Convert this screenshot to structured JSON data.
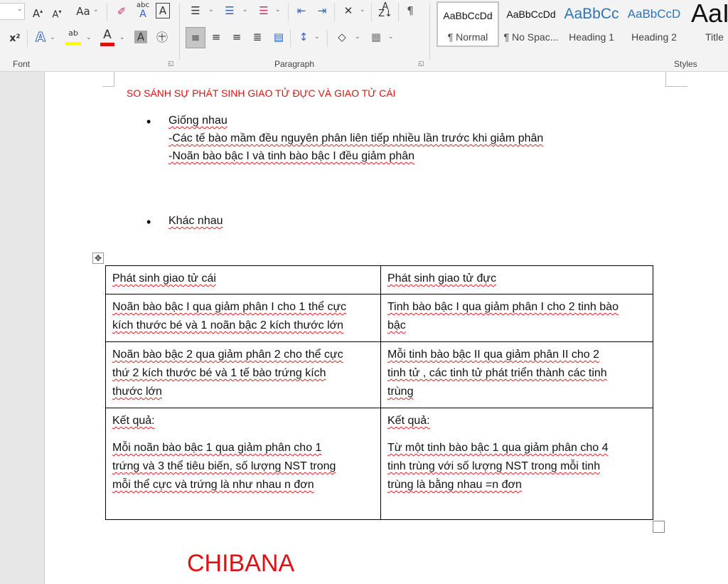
{
  "ribbon": {
    "font_group": {
      "label": "Font",
      "row1": {
        "grow_font": "A",
        "shrink_font": "A",
        "change_case": "Aa",
        "clear_format": "✐",
        "text_effects_abc": "abc",
        "char_border": "A"
      },
      "row2": {
        "superscript": "x²",
        "text_effect": "A",
        "highlight": "ab",
        "font_color": "A",
        "char_shading": "A",
        "enclose": "㊉"
      }
    },
    "paragraph_group": {
      "label": "Paragraph",
      "pilcrow": "¶",
      "sort": "↓",
      "bullets": "☰",
      "numbering": "☰",
      "multilevel": "☰",
      "decrease_indent": "⇤",
      "increase_indent": "⇥",
      "line_spacing": "↕",
      "shading": "◇",
      "borders": "▦"
    },
    "styles_group": {
      "label": "Styles",
      "items": [
        {
          "sample": "AaBbCcDd",
          "name": "¶ Normal"
        },
        {
          "sample": "AaBbCcDd",
          "name": "¶ No Spac..."
        },
        {
          "sample": "AaBbCc",
          "name": "Heading 1"
        },
        {
          "sample": "AaBbCcD",
          "name": "Heading 2"
        },
        {
          "sample": "AaI",
          "name": "Title"
        }
      ]
    }
  },
  "document": {
    "title": "SO SÁNH SỰ PHÁT SINH GIAO TỬ ĐỰC VÀ GIAO TỬ CÁI",
    "similar": {
      "heading": "Giống nhau",
      "lines": [
        "-Các tế bào mầm đều nguyên phân liên tiếp nhiều lần trước khi giảm phân",
        "-Noãn bào bậc I và tinh bào bậc I đều giảm phân"
      ]
    },
    "different": {
      "heading": "Khác nhau"
    },
    "table": {
      "headers": [
        "Phát sinh giao tử cái",
        "Phát sinh giao tử đực"
      ],
      "rows": [
        {
          "left": [
            "Noãn bào bậc I qua giảm phân I cho 1 thể cực",
            "kích thước bé và 1 noãn bậc 2 kích thước lớn"
          ],
          "right": [
            "Tinh bào bậc I qua giảm phân I cho 2 tinh bào",
            "bậc"
          ]
        },
        {
          "left": [
            "Noãn bào bậc 2 qua giảm phân 2 cho thể cực",
            "thứ 2 kích thước bé và 1 tế bào trứng kích",
            "thước lớn"
          ],
          "right": [
            "Mỗi tinh bào bậc II qua giảm phân II cho 2",
            "tinh tử , các tinh tử phát triển thành các tinh",
            "trùng"
          ]
        },
        {
          "left_heading": "Kết quả:",
          "left": [
            "Mỗi noãn bào bậc 1 qua giảm phân cho 1",
            "trứng và 3 thể tiêu biến, số lượng NST trong",
            "mỗi thể cực và trứng là như nhau n đơn"
          ],
          "right_heading": "Kết quả:",
          "right": [
            "Từ một tinh bào bậc 1 qua giảm phân cho 4",
            "tinh trùng với số lượng NST trong mỗi tinh",
            "trùng là bằng nhau =n đơn"
          ]
        }
      ]
    },
    "watermark": "CHIBANA"
  },
  "colors": {
    "title_red": "#e01010",
    "highlight_yellow": "#ffff00",
    "font_color_red": "#e01010",
    "style_heading_blue": "#2e74b5"
  }
}
